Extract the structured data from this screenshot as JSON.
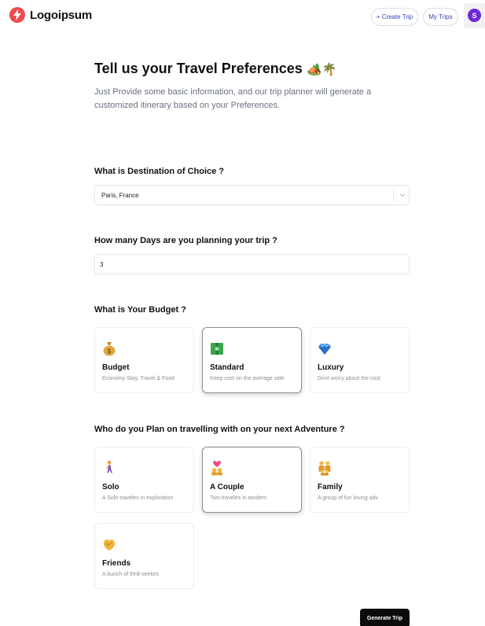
{
  "header": {
    "logo_text": "Logoipsum",
    "create_trip_label": "+ Create Trip",
    "my_trips_label": "My Trips",
    "avatar_initial": "S"
  },
  "intro": {
    "title": "Tell us your Travel Preferences",
    "title_emoji": "🏕️🌴",
    "description": "Just Provide some basic information, and our trip planner will generate a customized itinerary based on your Preferences."
  },
  "destination": {
    "label": "What is Destination of Choice ?",
    "value": "Paris, France"
  },
  "days": {
    "label": "How many Days are you planning your trip ?",
    "value": "3"
  },
  "budget": {
    "label": "What is Your Budget ?",
    "options": [
      {
        "title": "Budget",
        "desc": "Economy Stay, Travel & Food",
        "icon": "money-bag-icon",
        "selected": false
      },
      {
        "title": "Standard",
        "desc": "Keep cost on the average side",
        "icon": "banknote-icon",
        "selected": true
      },
      {
        "title": "Luxury",
        "desc": "Dont worry about the cost",
        "icon": "diamond-icon",
        "selected": false
      }
    ]
  },
  "travelers": {
    "label": "Who do you Plan on travelling with on your next Adventure ?",
    "options": [
      {
        "title": "Solo",
        "desc": "A Sole traveles in exploration",
        "icon": "walking-person-icon",
        "selected": false
      },
      {
        "title": "A Couple",
        "desc": "Two traveles in tandem",
        "icon": "couple-heart-icon",
        "selected": true
      },
      {
        "title": "Family",
        "desc": "A group of fun loving adv",
        "icon": "family-icon",
        "selected": false
      },
      {
        "title": "Friends",
        "desc": "A bunch of thrill-seekes",
        "icon": "handshake-icon",
        "selected": false
      }
    ]
  },
  "actions": {
    "generate_label": "Generate Trip"
  },
  "colors": {
    "brand": "#ef4b4b",
    "link": "#3b3fb5",
    "avatar": "#6d28d9",
    "primary_button": "#0b0b0b"
  }
}
